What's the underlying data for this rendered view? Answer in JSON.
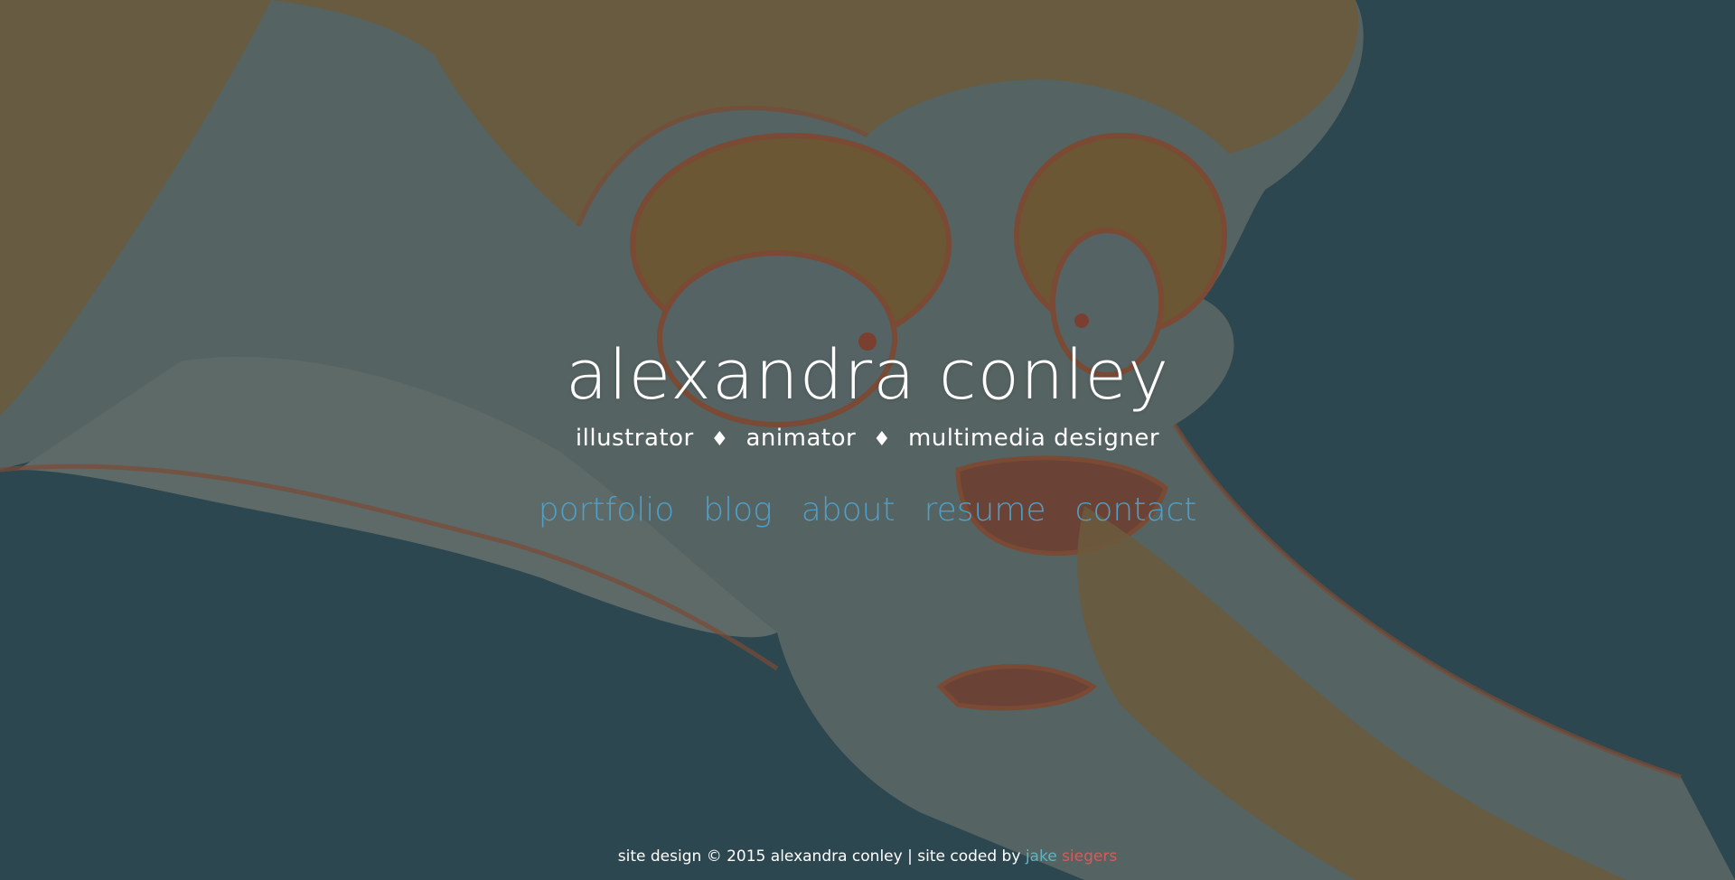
{
  "header": {
    "name": "alexandra conley",
    "roles": [
      "illustrator",
      "animator",
      "multimedia designer"
    ],
    "separator": "♦"
  },
  "nav": {
    "items": [
      {
        "label": "portfolio"
      },
      {
        "label": "blog"
      },
      {
        "label": "about"
      },
      {
        "label": "resume"
      },
      {
        "label": "contact"
      }
    ]
  },
  "footer": {
    "prefix": "site design",
    "copyright_symbol": "©",
    "year_owner": "2015 alexandra conley",
    "divider": "|",
    "coded_by": "site coded by",
    "coder_first": "jake",
    "coder_last": "siegers"
  },
  "colors": {
    "background": "#2c4750",
    "nav_link": "#4fa0c8",
    "coder_first": "#5fb4c2",
    "coder_last": "#d65b5b"
  }
}
